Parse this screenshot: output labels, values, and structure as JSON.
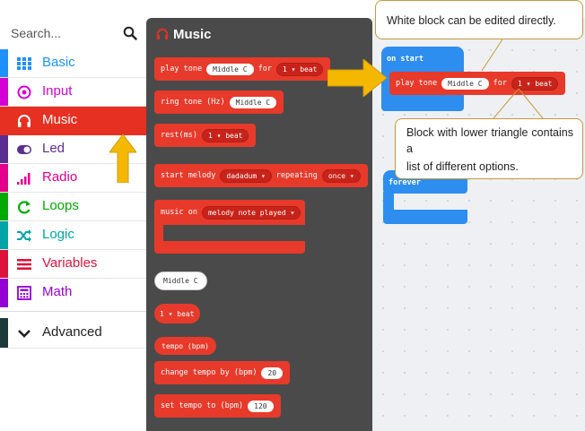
{
  "search": {
    "placeholder": "Search..."
  },
  "categories": [
    {
      "label": "Basic",
      "color": "#1e90ff",
      "icon": "grid-icon"
    },
    {
      "label": "Input",
      "color": "#d400d4",
      "icon": "target-icon"
    },
    {
      "label": "Music",
      "color": "#e63022",
      "icon": "headphones-icon"
    },
    {
      "label": "Led",
      "color": "#5c2d91",
      "icon": "toggle-icon"
    },
    {
      "label": "Radio",
      "color": "#e3008c",
      "icon": "signal-icon"
    },
    {
      "label": "Loops",
      "color": "#00aa00",
      "icon": "refresh-icon"
    },
    {
      "label": "Logic",
      "color": "#00a4a6",
      "icon": "shuffle-icon"
    },
    {
      "label": "Variables",
      "color": "#dc143c",
      "icon": "lines-icon"
    },
    {
      "label": "Math",
      "color": "#9400d3",
      "icon": "calculator-icon"
    }
  ],
  "advanced": {
    "label": "Advanced"
  },
  "flyout": {
    "title": "Music",
    "blocks": {
      "play_tone": {
        "text": "play tone",
        "note": "Middle C",
        "for": "for",
        "beat": "1 ▾ beat"
      },
      "ring_tone": {
        "text": "ring tone (Hz)",
        "note": "Middle C"
      },
      "rest": {
        "text": "rest(ms)",
        "beat": "1 ▾ beat"
      },
      "start_melody": {
        "text": "start melody",
        "melody": "dadadum ▾",
        "repeating": "repeating",
        "once": "once ▾"
      },
      "music_on": {
        "text": "music on",
        "event": "melody note played ▾"
      },
      "middle_c": {
        "note": "Middle C"
      },
      "beat": {
        "beat": "1 ▾ beat"
      },
      "tempo": {
        "text": "tempo (bpm)"
      },
      "change_tempo": {
        "text": "change tempo by (bpm)",
        "value": "20"
      },
      "set_tempo": {
        "text": "set tempo to (bpm)",
        "value": "120"
      }
    }
  },
  "workspace": {
    "on_start": {
      "label": "on start",
      "play_tone": {
        "text": "play tone",
        "note": "Middle C",
        "for": "for",
        "beat": "1 ▾ beat"
      }
    },
    "forever": {
      "label": "forever"
    }
  },
  "callouts": {
    "white": "White block can be edited directly.",
    "triangle_line1": "Block with lower triangle contains a",
    "triangle_line2": "list of different options."
  },
  "colors": {
    "music": "#e73a2b",
    "flyout_bg": "#4a4a4a",
    "hat_blue": "#2d8ef0",
    "arrow": "#f5b800"
  }
}
